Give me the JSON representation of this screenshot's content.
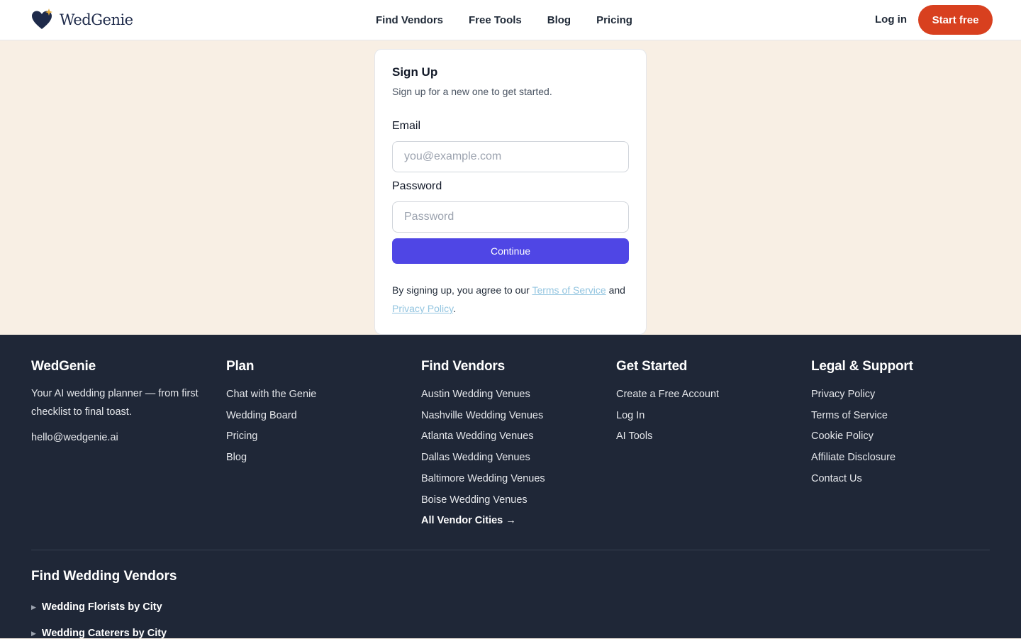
{
  "header": {
    "brand": "WedGenie",
    "nav": [
      "Find Vendors",
      "Free Tools",
      "Blog",
      "Pricing"
    ],
    "login_label": "Log in",
    "start_label": "Start free",
    "accent_color": "#d8401f"
  },
  "signup": {
    "title": "Sign Up",
    "subtitle": "Sign up for a new one to get started.",
    "email_label": "Email",
    "email_placeholder": "you@example.com",
    "password_label": "Password",
    "password_placeholder": "Password",
    "continue_label": "Continue",
    "terms_prefix": "By signing up, you agree to our",
    "terms_link": "Terms of Service",
    "terms_and": "and",
    "privacy_link": "Privacy Policy",
    "terms_suffix": ".",
    "button_color": "#4f46e5"
  },
  "footer": {
    "brand": {
      "title": "WedGenie",
      "tagline": "Your AI wedding planner — from first checklist to final toast.",
      "email": "hello@wedgenie.ai"
    },
    "plan": {
      "title": "Plan",
      "items": [
        "Chat with the Genie",
        "Wedding Board",
        "Pricing",
        "Blog"
      ]
    },
    "vendors": {
      "title": "Find Vendors",
      "items": [
        "Austin Wedding Venues",
        "Nashville Wedding Venues",
        "Atlanta Wedding Venues",
        "Dallas Wedding Venues",
        "Baltimore Wedding Venues",
        "Boise Wedding Venues"
      ],
      "all_label": "All Vendor Cities →"
    },
    "get_started": {
      "title": "Get Started",
      "items": [
        "Create a Free Account",
        "Log In",
        "AI Tools"
      ]
    },
    "legal": {
      "title": "Legal & Support",
      "items": [
        "Privacy Policy",
        "Terms of Service",
        "Cookie Policy",
        "Affiliate Disclosure",
        "Contact Us"
      ]
    },
    "find_wedding_vendors": {
      "title": "Find Wedding Vendors",
      "groups": [
        "Wedding Florists by City",
        "Wedding Caterers by City"
      ]
    },
    "background_color": "#1f2737"
  }
}
